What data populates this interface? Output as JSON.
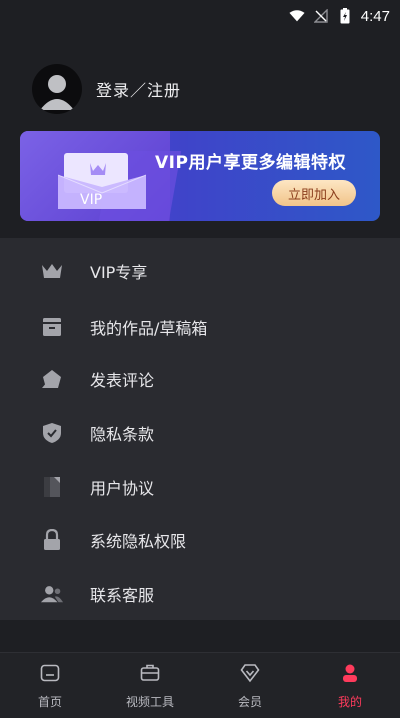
{
  "status_bar": {
    "time": "4:47"
  },
  "profile": {
    "login_label": "登录／注册"
  },
  "vip_banner": {
    "envelope_text": "VIP",
    "headline": "VIP用户享更多编辑特权",
    "join_button": "立即加入"
  },
  "menu": {
    "items": [
      {
        "label": "VIP专享",
        "icon": "crown-icon"
      },
      {
        "label": "我的作品/草稿箱",
        "icon": "box-icon"
      },
      {
        "label": "发表评论",
        "icon": "comment-icon"
      },
      {
        "label": "隐私条款",
        "icon": "shield-check-icon"
      },
      {
        "label": "用户协议",
        "icon": "agreement-icon"
      },
      {
        "label": "系统隐私权限",
        "icon": "lock-icon"
      },
      {
        "label": "联系客服",
        "icon": "users-icon"
      }
    ]
  },
  "bottom_nav": {
    "items": [
      {
        "label": "首页",
        "icon": "home-icon",
        "active": false
      },
      {
        "label": "视频工具",
        "icon": "toolbox-icon",
        "active": false
      },
      {
        "label": "会员",
        "icon": "diamond-icon",
        "active": false
      },
      {
        "label": "我的",
        "icon": "person-icon",
        "active": true
      }
    ]
  },
  "colors": {
    "background": "#1e1f23",
    "menu_panel": "#2a2b30",
    "accent_active": "#ff3b5c",
    "vip_button": "#f1c48a"
  }
}
